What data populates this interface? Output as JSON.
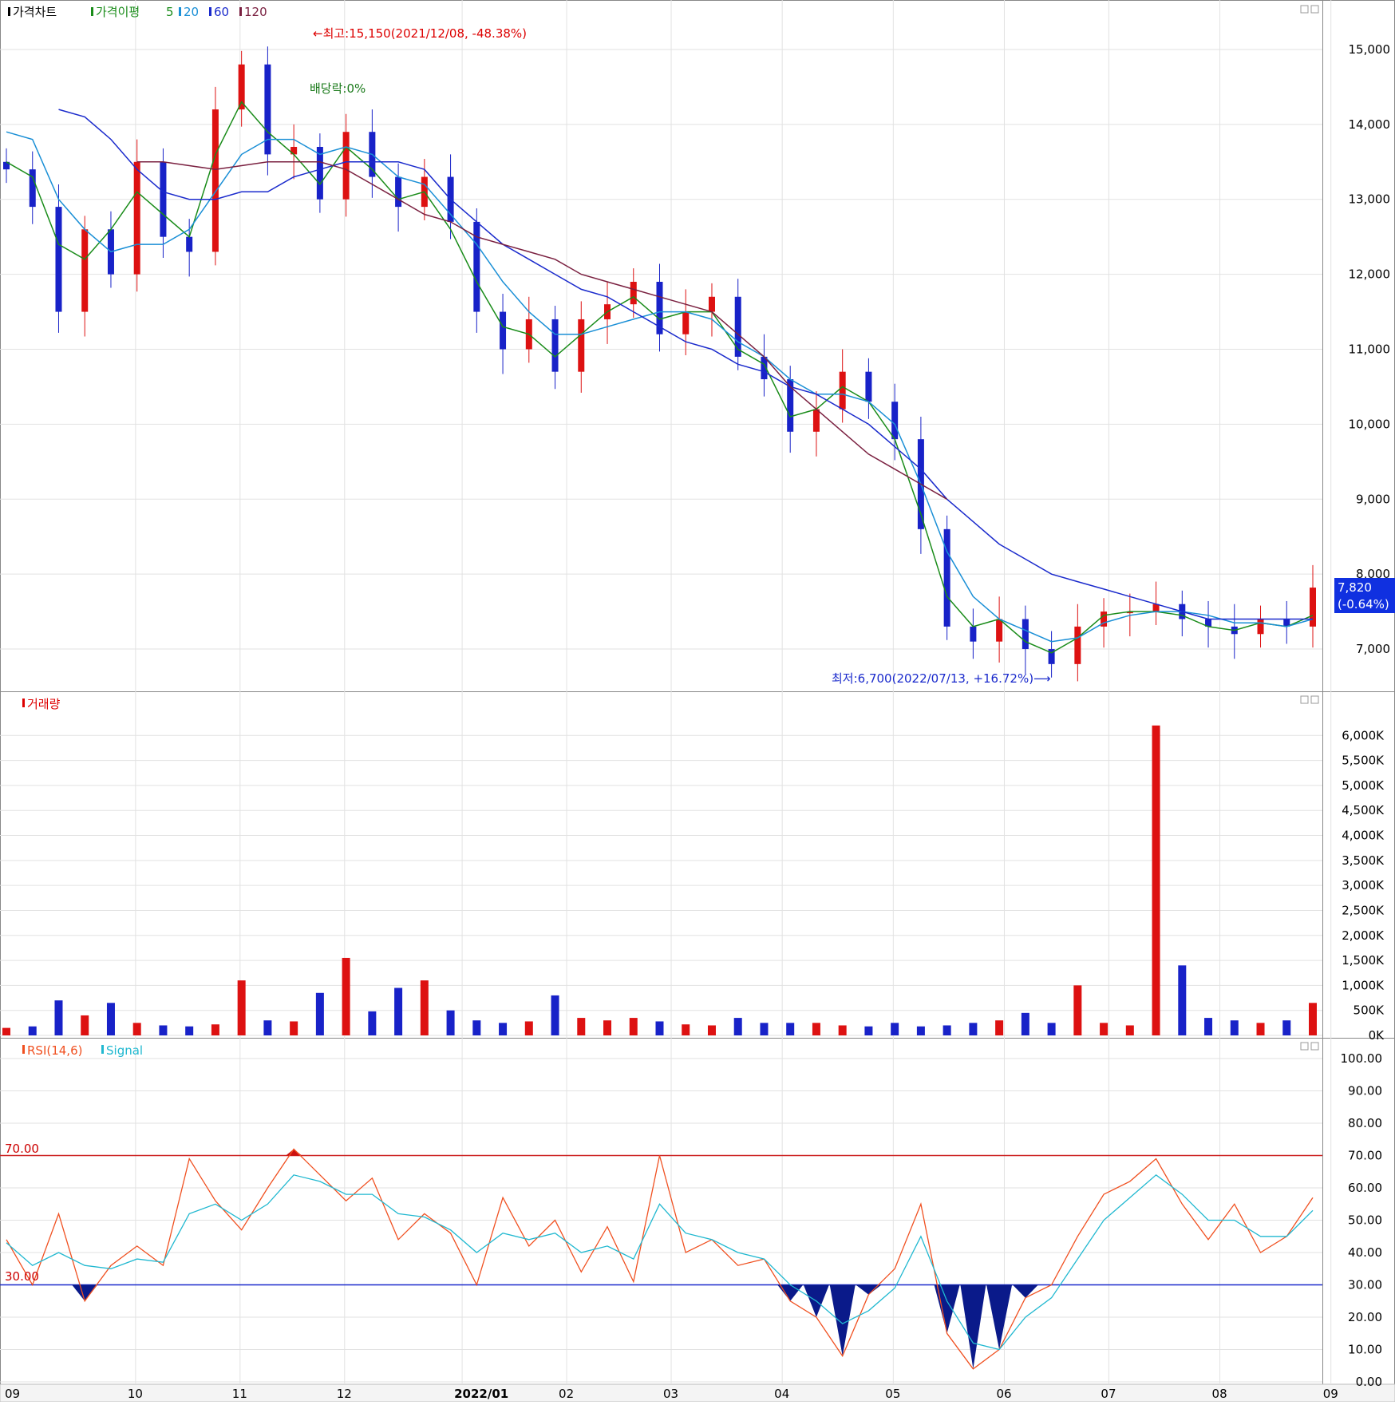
{
  "panels": {
    "price": {
      "legend": [
        {
          "label": "가격차트",
          "color": "#000000"
        },
        {
          "label": "가격이평",
          "color": "#1a8c1a"
        },
        {
          "label": "5",
          "color": "#1a8c1a"
        },
        {
          "label": "20",
          "color": "#1a8fd6"
        },
        {
          "label": "60",
          "color": "#1a2acc"
        },
        {
          "label": "120",
          "color": "#7a2040"
        }
      ],
      "max_note": "←최고:15,150(2021/12/08, -48.38%)",
      "ex_div_note": "배당락:0%",
      "min_note": "최저:6,700(2022/07/13, +16.72%)⟶",
      "last_price": "7,820",
      "last_change": "(-0.64%)"
    },
    "volume": {
      "legend": [
        {
          "label": "거래량",
          "color": "#dd0000"
        }
      ]
    },
    "rsi": {
      "legend": [
        {
          "label": "RSI(14,6)",
          "color": "#f05020"
        },
        {
          "label": "Signal",
          "color": "#20b8d0"
        }
      ],
      "upper_label": "70.00",
      "lower_label": "30.00"
    }
  },
  "chart_data": [
    {
      "type": "candlestick",
      "title": "가격차트",
      "ylim": [
        6500,
        15500
      ],
      "yticks": [
        "15,000",
        "14,000",
        "13,000",
        "12,000",
        "11,000",
        "10,000",
        "9,000",
        "8,000",
        "7,000"
      ],
      "x": [
        "2021-09",
        "2021-10",
        "2021-11",
        "2021-12",
        "2022-01",
        "2022-02",
        "2022-03",
        "2022-04",
        "2022-05",
        "2022-06",
        "2022-07",
        "2022-08",
        "2022-09"
      ],
      "close": [
        13400,
        12900,
        11500,
        12600,
        12000,
        13500,
        12500,
        12300,
        14200,
        14800,
        13600,
        13700,
        13000,
        13900,
        13300,
        12900,
        13300,
        12700,
        11500,
        11000,
        11400,
        10700,
        11400,
        11600,
        11900,
        11200,
        11500,
        11700,
        10900,
        10600,
        9900,
        10200,
        10700,
        10300,
        9800,
        8600,
        7300,
        7100,
        7400,
        7000,
        6800,
        7300,
        7500,
        7500,
        7600,
        7400,
        7300,
        7200,
        7400,
        7300,
        7820
      ],
      "max": {
        "value": 15150,
        "date": "2021/12/08",
        "change": "-48.38%"
      },
      "min": {
        "value": 6700,
        "date": "2022/07/13",
        "change": "+16.72%"
      },
      "last": {
        "value": 7820,
        "change": "-0.64%"
      }
    },
    {
      "type": "line",
      "title": "가격이평",
      "series": [
        {
          "name": "5",
          "color": "#1a8c1a",
          "values": [
            13500,
            13300,
            12400,
            12200,
            12600,
            13100,
            12800,
            12500,
            13600,
            14300,
            13900,
            13600,
            13200,
            13700,
            13400,
            13000,
            13100,
            12600,
            11900,
            11300,
            11200,
            10900,
            11200,
            11500,
            11700,
            11400,
            11500,
            11500,
            11000,
            10800,
            10100,
            10200,
            10500,
            10300,
            9800,
            8800,
            7700,
            7300,
            7400,
            7100,
            6950,
            7150,
            7450,
            7500,
            7500,
            7450,
            7300,
            7250,
            7350,
            7300,
            7450
          ]
        },
        {
          "name": "20",
          "color": "#1a8fd6",
          "values": [
            13900,
            13800,
            13000,
            12600,
            12300,
            12400,
            12400,
            12600,
            13100,
            13600,
            13800,
            13800,
            13600,
            13700,
            13600,
            13300,
            13200,
            12800,
            12400,
            11900,
            11500,
            11200,
            11200,
            11300,
            11400,
            11500,
            11500,
            11400,
            11100,
            10900,
            10600,
            10400,
            10400,
            10300,
            10000,
            9200,
            8300,
            7700,
            7400,
            7250,
            7100,
            7150,
            7350,
            7450,
            7500,
            7500,
            7450,
            7350,
            7350,
            7300,
            7400
          ]
        },
        {
          "name": "60",
          "color": "#1a2acc",
          "values": [
            null,
            null,
            14200,
            14100,
            13800,
            13400,
            13100,
            13000,
            13000,
            13100,
            13100,
            13300,
            13400,
            13500,
            13500,
            13500,
            13400,
            13000,
            12700,
            12400,
            12200,
            12000,
            11800,
            11700,
            11500,
            11300,
            11100,
            11000,
            10800,
            10700,
            10500,
            10400,
            10200,
            10000,
            9700,
            9400,
            9000,
            8700,
            8400,
            8200,
            8000,
            7900,
            7800,
            7700,
            7600,
            7500,
            7400,
            7400,
            7400,
            7400,
            7400
          ]
        },
        {
          "name": "120",
          "color": "#7a2040",
          "values": [
            null,
            null,
            null,
            null,
            null,
            13500,
            13500,
            13450,
            13400,
            13450,
            13500,
            13500,
            13500,
            13400,
            13200,
            13000,
            12800,
            12700,
            12500,
            12400,
            12300,
            12200,
            12000,
            11900,
            11800,
            11700,
            11600,
            11500,
            11200,
            10900,
            10500,
            10200,
            9900,
            9600,
            9400,
            9200,
            9000
          ]
        }
      ]
    },
    {
      "type": "bar",
      "title": "거래량",
      "ylim": [
        0,
        6500000
      ],
      "yticks": [
        "6,000K",
        "5,500K",
        "5,000K",
        "4,500K",
        "4,000K",
        "3,500K",
        "3,000K",
        "2,500K",
        "2,000K",
        "1,500K",
        "1,000K",
        "500K",
        "0K"
      ],
      "values": [
        150000,
        180000,
        700000,
        400000,
        650000,
        250000,
        200000,
        180000,
        220000,
        1100000,
        300000,
        280000,
        850000,
        1550000,
        480000,
        950000,
        1100000,
        500000,
        300000,
        250000,
        280000,
        800000,
        350000,
        300000,
        350000,
        280000,
        220000,
        200000,
        350000,
        250000,
        250000,
        250000,
        200000,
        180000,
        250000,
        180000,
        200000,
        250000,
        300000,
        450000,
        250000,
        1000000,
        250000,
        200000,
        6200000,
        1400000,
        350000,
        300000,
        250000,
        300000,
        650000
      ]
    },
    {
      "type": "line",
      "title": "RSI(14,6)",
      "ylim": [
        0,
        100
      ],
      "yticks": [
        "100.00",
        "90.00",
        "80.00",
        "70.00",
        "60.00",
        "50.00",
        "40.00",
        "30.00",
        "20.00",
        "10.00",
        "0.00"
      ],
      "series": [
        {
          "name": "RSI(14,6)",
          "color": "#f05020",
          "values": [
            44,
            30,
            52,
            25,
            36,
            42,
            36,
            69,
            56,
            47,
            60,
            72,
            64,
            56,
            63,
            44,
            52,
            46,
            30,
            57,
            42,
            50,
            34,
            48,
            31,
            70,
            40,
            44,
            36,
            38,
            25,
            20,
            8,
            27,
            35,
            55,
            15,
            4,
            10,
            26,
            30,
            45,
            58,
            62,
            69,
            55,
            44,
            55,
            40,
            45,
            57
          ]
        },
        {
          "name": "Signal",
          "color": "#20b8d0",
          "values": [
            43,
            36,
            40,
            36,
            35,
            38,
            37,
            52,
            55,
            50,
            55,
            64,
            62,
            58,
            58,
            52,
            51,
            47,
            40,
            46,
            44,
            46,
            40,
            42,
            38,
            55,
            46,
            44,
            40,
            38,
            30,
            25,
            18,
            22,
            29,
            45,
            25,
            12,
            10,
            20,
            26,
            38,
            50,
            57,
            64,
            58,
            50,
            50,
            45,
            45,
            53
          ]
        }
      ],
      "guides": [
        70,
        30
      ]
    }
  ],
  "x_axis_labels": [
    "09",
    "10",
    "11",
    "12",
    "2022/01",
    "02",
    "03",
    "04",
    "05",
    "06",
    "07",
    "08",
    "09"
  ]
}
